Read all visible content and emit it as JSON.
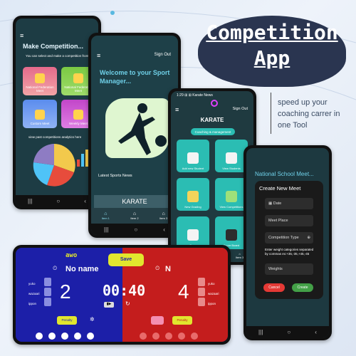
{
  "banner": {
    "title_line1": "Competition",
    "title_line2": "App",
    "tagline": "speed up your coaching carrer in one Tool"
  },
  "phone1": {
    "title": "Make Competition...",
    "subtitle": "You can select and make a competition from",
    "tiles": [
      {
        "label": "National Federation Meet"
      },
      {
        "label": "National Federation Meet"
      },
      {
        "label": "Custom Meet"
      },
      {
        "label": "Weekly Meet"
      }
    ],
    "analytics_label": "view past competitions analytics here"
  },
  "phone2": {
    "signout": "Sign Out",
    "welcome": "Welcome to your Sport Manager...",
    "latest_news": "Latest Sports News",
    "karate_tab": "KARATE",
    "nav": [
      "Item 1",
      "Item 2",
      "Item 3"
    ]
  },
  "phone3": {
    "status": "1:29 ⊞ ⊞ Karate News",
    "signout": "Sign Out",
    "karate": "KARATE",
    "chip": "Coaching & management",
    "cards": [
      "Add new Student",
      "View Students",
      "New Grading",
      "View Competitions",
      "Docs",
      "Score Board"
    ],
    "nav": [
      "Item 1",
      "Item 2",
      "Item 3"
    ]
  },
  "phone4": {
    "header": "National School Meet...",
    "dialog_title": "Create New Meet",
    "date_placeholder": "Date",
    "place_placeholder": "Meet Place",
    "type_label": "Competition Type",
    "hint": "Enter weight categories separated by commas ex:+35,-35,+45,-45",
    "weights_placeholder": "Weights",
    "cancel": "Cancel",
    "create": "Create"
  },
  "scoreboard": {
    "awo": "awo",
    "save": "Save",
    "left_name": "No name",
    "right_name": "N",
    "left_score": "2",
    "right_score": "4",
    "timer": "00:40",
    "labels": [
      "yuko",
      "wazaari",
      "ippon"
    ],
    "penalty": "Penalty",
    "colors": {
      "blue": "#1c1fa8",
      "red": "#c41d1d",
      "save": "#e1e62e"
    }
  },
  "colors": {
    "teal": "#2bbdb3",
    "dark": "#1f3a40",
    "accent": "#6fd0e8"
  }
}
